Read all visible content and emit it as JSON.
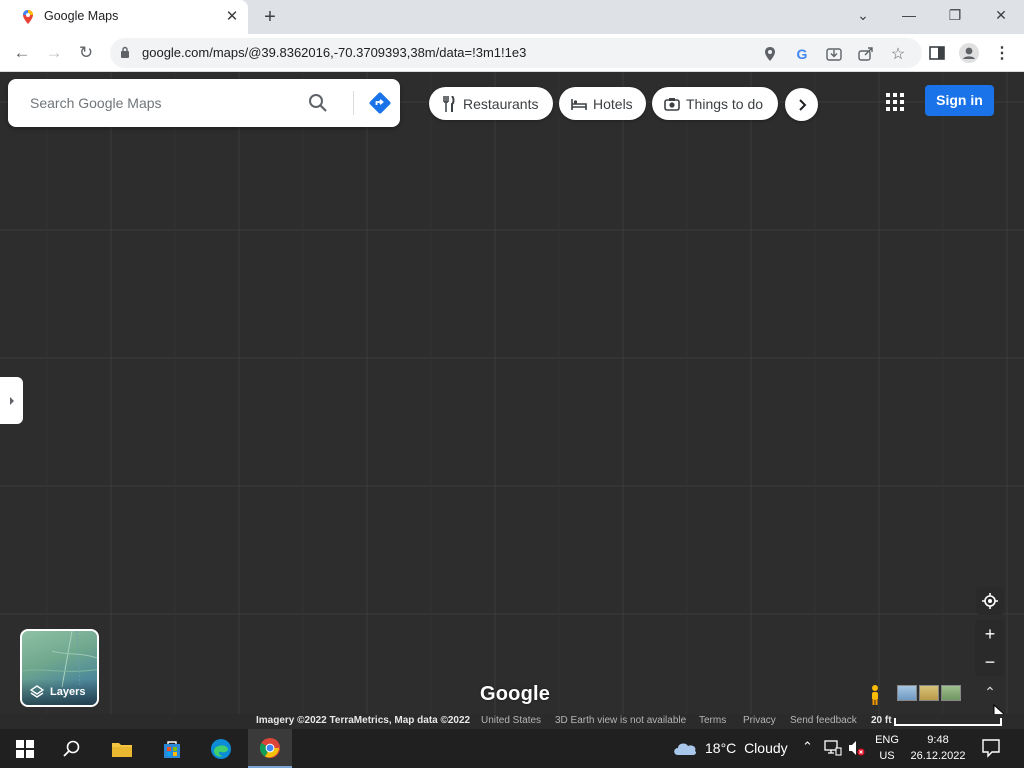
{
  "browser": {
    "tab_title": "Google Maps",
    "url": "google.com/maps/@39.8362016,-70.3709393,38m/data=!3m1!1e3"
  },
  "search": {
    "placeholder": "Search Google Maps"
  },
  "chips": [
    {
      "label": "Restaurants",
      "icon": "fork-knife-icon"
    },
    {
      "label": "Hotels",
      "icon": "bed-icon"
    },
    {
      "label": "Things to do",
      "icon": "camera-icon"
    }
  ],
  "header": {
    "signin_label": "Sign in"
  },
  "layers": {
    "label": "Layers"
  },
  "map": {
    "logo_text": "Google",
    "imagery_credit": "Imagery ©2022 TerraMetrics, Map data ©2022",
    "region": "United States",
    "earth_notice": "3D Earth view is not available",
    "terms": "Terms",
    "privacy": "Privacy",
    "feedback": "Send feedback",
    "scale": "20 ft"
  },
  "taskbar": {
    "weather_temp": "18°C",
    "weather_desc": "Cloudy",
    "lang_line1": "ENG",
    "lang_line2": "US",
    "time": "9:48",
    "date": "26.12.2022"
  },
  "colors": {
    "accent": "#1a73e8",
    "map_bg": "#2d2d2d",
    "taskbar_bg": "#202020"
  }
}
